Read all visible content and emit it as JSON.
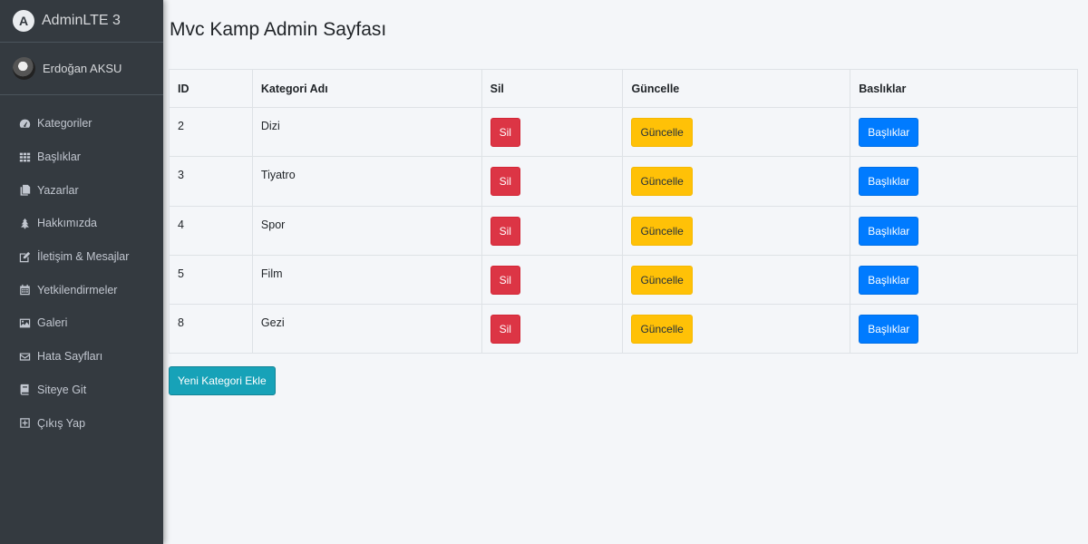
{
  "brand": {
    "name": "AdminLTE 3"
  },
  "user": {
    "name": "Erdoğan AKSU"
  },
  "nav": [
    {
      "label": "Kategoriler",
      "icon": "tachometer-icon"
    },
    {
      "label": "Başlıklar",
      "icon": "grid-icon"
    },
    {
      "label": "Yazarlar",
      "icon": "copy-icon"
    },
    {
      "label": "Hakkımızda",
      "icon": "tree-icon"
    },
    {
      "label": "İletişim & Mesajlar",
      "icon": "edit-icon"
    },
    {
      "label": "Yetkilendirmeler",
      "icon": "calendar-icon"
    },
    {
      "label": "Galeri",
      "icon": "image-icon"
    },
    {
      "label": "Hata Sayfları",
      "icon": "envelope-icon"
    },
    {
      "label": "Siteye Git",
      "icon": "book-icon"
    },
    {
      "label": "Çıkış Yap",
      "icon": "plus-square-icon"
    }
  ],
  "page": {
    "title": "Mvc Kamp Admin Sayfası"
  },
  "table": {
    "headers": [
      "ID",
      "Kategori Adı",
      "Sil",
      "Güncelle",
      "Baslıklar"
    ],
    "rows": [
      {
        "id": "2",
        "name": "Dizi"
      },
      {
        "id": "3",
        "name": "Tiyatro"
      },
      {
        "id": "4",
        "name": "Spor"
      },
      {
        "id": "5",
        "name": "Film"
      },
      {
        "id": "8",
        "name": "Gezi"
      }
    ],
    "delete_label": "Sil",
    "update_label": "Güncelle",
    "titles_label": "Başlıklar"
  },
  "add_button": {
    "label": "Yeni Kategori Ekle"
  },
  "colors": {
    "sidebar": "#343a40",
    "danger": "#dc3545",
    "warning": "#ffc107",
    "primary": "#007bff",
    "info": "#17a2b8"
  }
}
